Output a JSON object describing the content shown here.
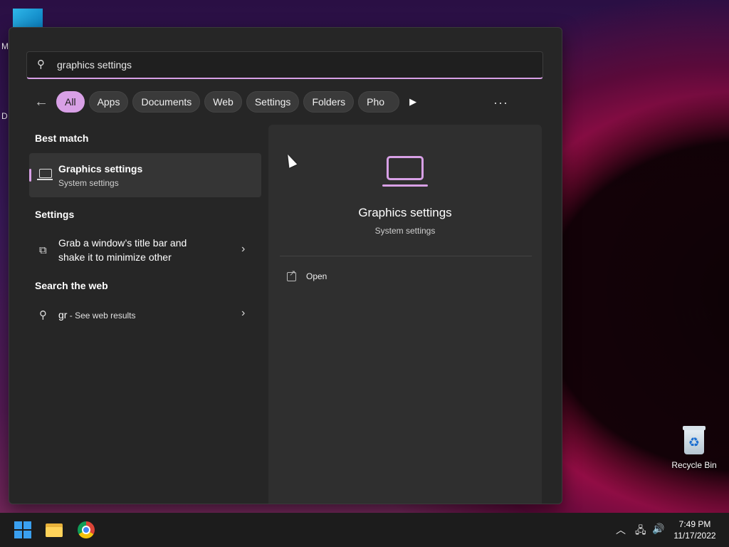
{
  "desktop": {
    "fragments": [
      "M",
      "D"
    ],
    "recycle_bin_label": "Recycle Bin"
  },
  "search": {
    "query": "graphics settings"
  },
  "filters": [
    "All",
    "Apps",
    "Documents",
    "Web",
    "Settings",
    "Folders",
    "Pho"
  ],
  "left": {
    "best_match_heading": "Best match",
    "best_match": {
      "title": "Graphics settings",
      "subtitle": "System settings"
    },
    "settings_heading": "Settings",
    "settings_item": {
      "line1": "Grab a window’s title bar and",
      "line2": "shake it to minimize other"
    },
    "web_heading": "Search the web",
    "web_item": {
      "query": "gr",
      "suffix": " - See web results"
    }
  },
  "preview": {
    "title": "Graphics settings",
    "subtitle": "System settings",
    "action_open": "Open"
  },
  "taskbar": {
    "time": "7:49 PM",
    "date": "11/17/2022"
  },
  "colors": {
    "accent": "#d8a0e6",
    "panel": "#262626"
  }
}
